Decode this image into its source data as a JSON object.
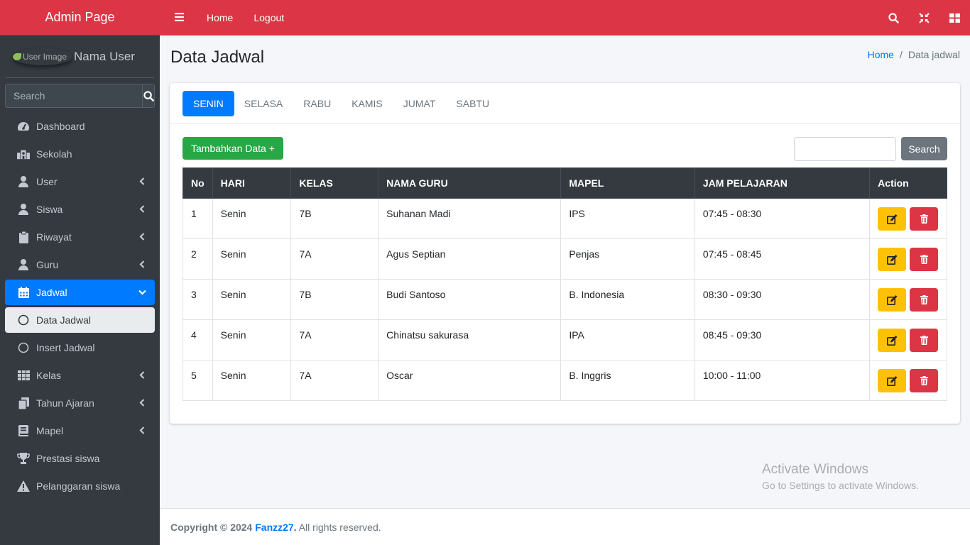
{
  "brand": "Admin Page",
  "user": {
    "image_alt": "User Image",
    "name": "Nama User"
  },
  "sidebar_search": {
    "placeholder": "Search"
  },
  "nav": [
    {
      "label": "Dashboard",
      "icon": "dashboard-icon"
    },
    {
      "label": "Sekolah",
      "icon": "school-icon"
    },
    {
      "label": "User",
      "icon": "user-icon"
    },
    {
      "label": "Siswa",
      "icon": "user-icon"
    },
    {
      "label": "Riwayat",
      "icon": "clipboard-icon"
    },
    {
      "label": "Guru",
      "icon": "user-icon"
    },
    {
      "label": "Jadwal",
      "icon": "calendar-icon"
    },
    {
      "label": "Data Jadwal",
      "icon": "circle-icon"
    },
    {
      "label": "Insert Jadwal",
      "icon": "circle-icon"
    },
    {
      "label": "Kelas",
      "icon": "grid-icon"
    },
    {
      "label": "Tahun Ajaran",
      "icon": "copy-icon"
    },
    {
      "label": "Mapel",
      "icon": "book-icon"
    },
    {
      "label": "Prestasi siswa",
      "icon": "trophy-icon"
    },
    {
      "label": "Pelanggaran siswa",
      "icon": "warning-icon"
    }
  ],
  "topbar": {
    "home": "Home",
    "logout": "Logout"
  },
  "page": {
    "title": "Data Jadwal"
  },
  "breadcrumb": {
    "home": "Home",
    "sep": "/",
    "current": "Data jadwal"
  },
  "tabs": [
    "SENIN",
    "SELASA",
    "RABU",
    "KAMIS",
    "JUMAT",
    "SABTU"
  ],
  "add_button": "Tambahkan Data +",
  "search_button": "Search",
  "table": {
    "headers": [
      "No",
      "HARI",
      "KELAS",
      "NAMA GURU",
      "MAPEL",
      "JAM PELAJARAN",
      "Action"
    ],
    "rows": [
      [
        "1",
        "Senin",
        "7B",
        "Suhanan Madi",
        "IPS",
        "07:45 - 08:30"
      ],
      [
        "2",
        "Senin",
        "7A",
        "Agus Septian",
        "Penjas",
        "07:45 - 08:45"
      ],
      [
        "3",
        "Senin",
        "7B",
        "Budi Santoso",
        "B. Indonesia",
        "08:30 - 09:30"
      ],
      [
        "4",
        "Senin",
        "7A",
        "Chinatsu sakurasa",
        "IPA",
        "08:45 - 09:30"
      ],
      [
        "5",
        "Senin",
        "7A",
        "Oscar",
        "B. Inggris",
        "10:00 - 11:00"
      ]
    ]
  },
  "watermark": {
    "line1": "Activate Windows",
    "line2": "Go to Settings to activate Windows."
  },
  "footer": {
    "prefix": "Copyright © 2024 ",
    "brand": "Fanzz27.",
    "suffix": " All rights reserved."
  },
  "colors": {
    "primary": "#007bff",
    "danger": "#dc3545",
    "success": "#28a745",
    "warning": "#ffc107",
    "sidebar": "#343a40"
  }
}
